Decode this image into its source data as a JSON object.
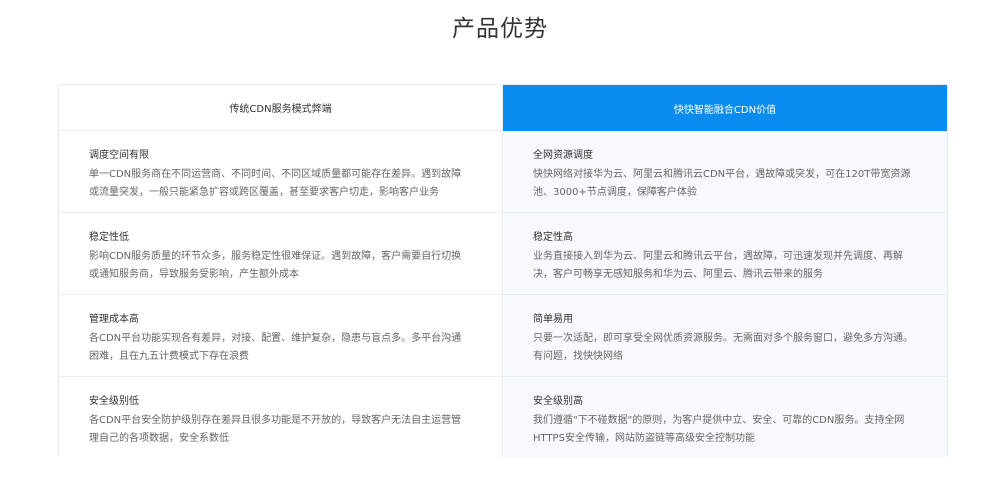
{
  "page": {
    "title": "产品优势"
  },
  "table": {
    "headers": {
      "left": "传统CDN服务模式弊端",
      "right": "快快智能融合CDN价值"
    },
    "rows": [
      {
        "left": {
          "title": "调度空间有限",
          "desc": "单一CDN服务商在不同运营商、不同时间、不同区域质量都可能存在差异。遇到故障或流量突发，一般只能紧急扩容或跨区覆盖，甚至要求客户切走，影响客户业务"
        },
        "right": {
          "title": "全网资源调度",
          "desc": "快快网络对接华为云、阿里云和腾讯云CDN平台，遇故障或突发，可在120T带宽资源池、3000+节点调度，保障客户体验"
        }
      },
      {
        "left": {
          "title": "稳定性低",
          "desc": "影响CDN服务质量的环节众多，服务稳定性很难保证。遇到故障，客户需要自行切换或通知服务商，导致服务受影响，产生额外成本"
        },
        "right": {
          "title": "稳定性高",
          "desc": "业务直接接入到华为云、阿里云和腾讯云平台，遇故障，可迅速发现并先调度、再解决，客户可畅享无感知服务和华为云、阿里云、腾讯云带来的服务"
        }
      },
      {
        "left": {
          "title": "管理成本高",
          "desc": "各CDN平台功能实现各有差异，对接、配置、维护复杂，隐患与盲点多。多平台沟通困难，且在九五计费模式下存在浪费"
        },
        "right": {
          "title": "简单易用",
          "desc": "只要一次适配，即可享受全网优质资源服务。无需面对多个服务窗口，避免多方沟通。有问题，找快快网络"
        }
      },
      {
        "left": {
          "title": "安全级别低",
          "desc": "各CDN平台安全防护级别存在差异且很多功能是不开放的，导致客户无法自主运营管理自己的各项数据，安全系数低"
        },
        "right": {
          "title": "安全级别高",
          "desc": "我们遵循\"下不碰数据\"的原则，为客户提供中立、安全、可靠的CDN服务。支持全网HTTPS安全传输，网站防盗链等高级安全控制功能"
        }
      }
    ]
  },
  "colors": {
    "accent": "#0a8cef",
    "border": "#e8edf2",
    "right_cell_bg": "#f6fafe"
  }
}
